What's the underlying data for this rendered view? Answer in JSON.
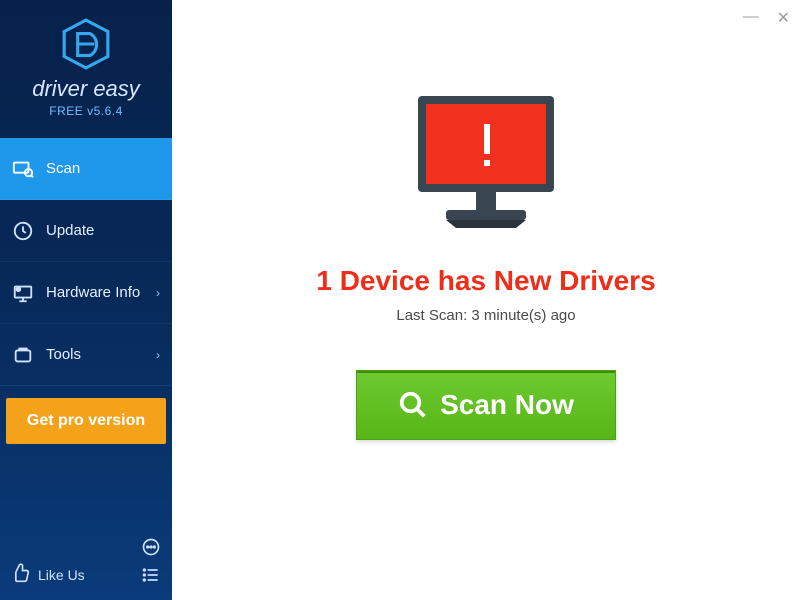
{
  "brand": "driver easy",
  "version": "FREE v5.6.4",
  "sidebar": {
    "items": [
      {
        "label": "Scan"
      },
      {
        "label": "Update"
      },
      {
        "label": "Hardware Info"
      },
      {
        "label": "Tools"
      }
    ],
    "pro_label": "Get pro version",
    "like_label": "Like Us"
  },
  "main": {
    "headline": "1 Device has New Drivers",
    "subline": "Last Scan: 3 minute(s) ago",
    "scan_label": "Scan Now"
  },
  "colors": {
    "accent_red": "#ef2e1a",
    "accent_green": "#58b518",
    "accent_orange": "#f5a21b",
    "sidebar_active": "#1f97ea"
  }
}
